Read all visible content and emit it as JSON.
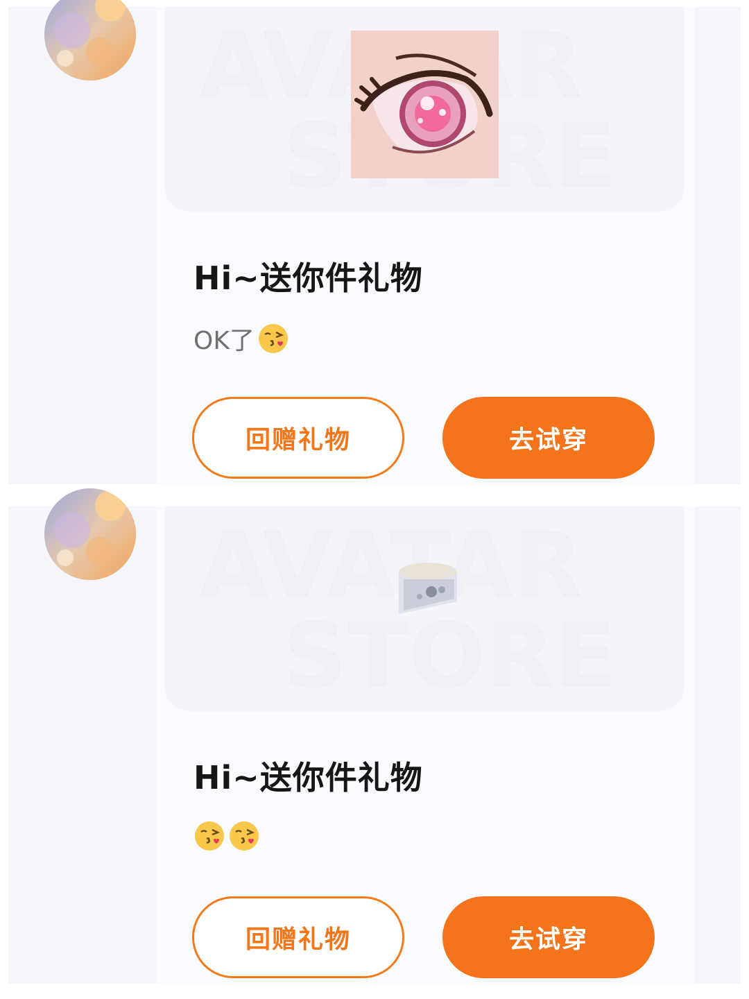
{
  "brand": {
    "accent": "#F5731A",
    "watermark_line1": "AVATAR",
    "watermark_line2": "STORE"
  },
  "messages": [
    {
      "avatar_icon": "sunset-anime-avatar",
      "item_icon": "anime-eye-icon",
      "title": "Hi~送你件礼物",
      "text": "OK了",
      "emojis": [
        "kissing-face-icon"
      ],
      "return_gift_label": "回赠礼物",
      "try_on_label": "去试穿"
    },
    {
      "avatar_icon": "sunset-anime-avatar",
      "item_icon": "hat-brim-icon",
      "title": "Hi~送你件礼物",
      "text": "",
      "emojis": [
        "kissing-face-icon",
        "kissing-face-icon"
      ],
      "return_gift_label": "回赠礼物",
      "try_on_label": "去试穿"
    }
  ]
}
